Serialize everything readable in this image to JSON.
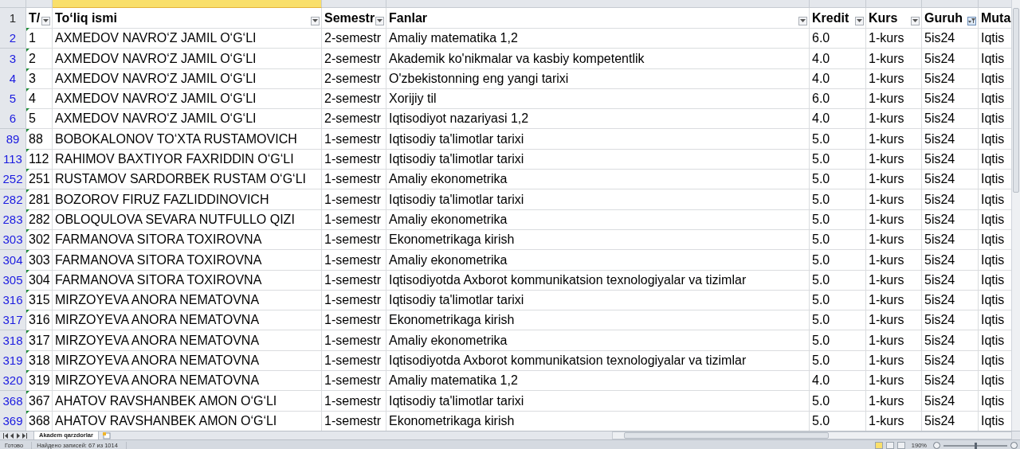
{
  "column_headers": [
    {
      "selected": false
    },
    {
      "selected": true
    },
    {
      "selected": false
    },
    {
      "selected": false
    },
    {
      "selected": false
    },
    {
      "selected": false
    },
    {
      "selected": false
    },
    {
      "selected": false
    }
  ],
  "header_row": {
    "number": "1",
    "cells": [
      {
        "text": "T/",
        "filter_button": true,
        "filtered": false
      },
      {
        "text": "To‘liq ismi",
        "filter_button": true,
        "filtered": false
      },
      {
        "text": "Semestr",
        "filter_button": true,
        "filtered": false
      },
      {
        "text": "Fanlar",
        "filter_button": true,
        "filtered": false
      },
      {
        "text": "Kredit",
        "filter_button": true,
        "filtered": false
      },
      {
        "text": "Kurs",
        "filter_button": true,
        "filtered": false
      },
      {
        "text": "Guruh",
        "filter_button": true,
        "filtered": true
      },
      {
        "text": "Muta",
        "filter_button": false
      }
    ]
  },
  "rows": [
    {
      "number": "2",
      "cells": [
        "1",
        "AXMEDOV NAVRO‘Z JAMIL O‘G‘LI",
        "2-semestr",
        "Amaliy matematika 1,2",
        "6.0",
        "1-kurs",
        "5is24",
        "Iqtis"
      ]
    },
    {
      "number": "3",
      "cells": [
        "2",
        "AXMEDOV NAVRO‘Z JAMIL O‘G‘LI",
        "2-semestr",
        "Akademik ko'nikmalar va kasbiy kompetentlik",
        "4.0",
        "1-kurs",
        "5is24",
        "Iqtis"
      ]
    },
    {
      "number": "4",
      "cells": [
        "3",
        "AXMEDOV NAVRO‘Z JAMIL O‘G‘LI",
        "2-semestr",
        "O'zbekistonning eng yangi tarixi",
        "4.0",
        "1-kurs",
        "5is24",
        "Iqtis"
      ]
    },
    {
      "number": "5",
      "cells": [
        "4",
        "AXMEDOV NAVRO‘Z JAMIL O‘G‘LI",
        "2-semestr",
        "Xorijiy til",
        "6.0",
        "1-kurs",
        "5is24",
        "Iqtis"
      ]
    },
    {
      "number": "6",
      "cells": [
        "5",
        "AXMEDOV NAVRO‘Z JAMIL O‘G‘LI",
        "2-semestr",
        "Iqtisodiyot nazariyasi 1,2",
        "4.0",
        "1-kurs",
        "5is24",
        "Iqtis"
      ]
    },
    {
      "number": "89",
      "cells": [
        "88",
        "BOBOKALONOV TO‘XTA RUSTAMOVICH",
        "1-semestr",
        "Iqtisodiy ta'limotlar tarixi",
        "5.0",
        "1-kurs",
        "5is24",
        "Iqtis"
      ]
    },
    {
      "number": "113",
      "cells": [
        "112",
        "RAHIMOV BAXTIYOR FAXRIDDIN O‘G‘LI",
        "1-semestr",
        "Iqtisodiy ta'limotlar tarixi",
        "5.0",
        "1-kurs",
        "5is24",
        "Iqtis"
      ]
    },
    {
      "number": "252",
      "cells": [
        "251",
        "RUSTAMOV SARDORBEK RUSTAM O‘G‘LI",
        "1-semestr",
        "Amaliy ekonometrika",
        "5.0",
        "1-kurs",
        "5is24",
        "Iqtis"
      ]
    },
    {
      "number": "282",
      "cells": [
        "281",
        "BOZOROV FIRUZ FAZLIDDINOVICH",
        "1-semestr",
        "Iqtisodiy ta'limotlar tarixi",
        "5.0",
        "1-kurs",
        "5is24",
        "Iqtis"
      ]
    },
    {
      "number": "283",
      "cells": [
        "282",
        "OBLOQULOVA SEVARA NUTFULLO QIZI",
        "1-semestr",
        "Amaliy ekonometrika",
        "5.0",
        "1-kurs",
        "5is24",
        "Iqtis"
      ]
    },
    {
      "number": "303",
      "cells": [
        "302",
        "FARMANOVA SITORA TOXIROVNA",
        "1-semestr",
        "Ekonometrikaga kirish",
        "5.0",
        "1-kurs",
        "5is24",
        "Iqtis"
      ]
    },
    {
      "number": "304",
      "cells": [
        "303",
        "FARMANOVA SITORA TOXIROVNA",
        "1-semestr",
        "Amaliy ekonometrika",
        "5.0",
        "1-kurs",
        "5is24",
        "Iqtis"
      ]
    },
    {
      "number": "305",
      "cells": [
        "304",
        "FARMANOVA SITORA TOXIROVNA",
        "1-semestr",
        "Iqtisodiyotda Axborot kommunikatsion texnologiyalar va tizimlar",
        "5.0",
        "1-kurs",
        "5is24",
        "Iqtis"
      ]
    },
    {
      "number": "316",
      "cells": [
        "315",
        "MIRZOYEVA ANORA NEMATOVNA",
        "1-semestr",
        "Iqtisodiy ta'limotlar tarixi",
        "5.0",
        "1-kurs",
        "5is24",
        "Iqtis"
      ]
    },
    {
      "number": "317",
      "cells": [
        "316",
        "MIRZOYEVA ANORA NEMATOVNA",
        "1-semestr",
        "Ekonometrikaga kirish",
        "5.0",
        "1-kurs",
        "5is24",
        "Iqtis"
      ]
    },
    {
      "number": "318",
      "cells": [
        "317",
        "MIRZOYEVA ANORA NEMATOVNA",
        "1-semestr",
        "Amaliy ekonometrika",
        "5.0",
        "1-kurs",
        "5is24",
        "Iqtis"
      ]
    },
    {
      "number": "319",
      "cells": [
        "318",
        "MIRZOYEVA ANORA NEMATOVNA",
        "1-semestr",
        "Iqtisodiyotda Axborot kommunikatsion texnologiyalar va tizimlar",
        "5.0",
        "1-kurs",
        "5is24",
        "Iqtis"
      ]
    },
    {
      "number": "320",
      "cells": [
        "319",
        "MIRZOYEVA ANORA NEMATOVNA",
        "1-semestr",
        "Amaliy matematika 1,2",
        "4.0",
        "1-kurs",
        "5is24",
        "Iqtis"
      ]
    },
    {
      "number": "368",
      "cells": [
        "367",
        "AHATOV RAVSHANBEK AMON O‘G‘LI",
        "1-semestr",
        "Iqtisodiy ta'limotlar tarixi",
        "5.0",
        "1-kurs",
        "5is24",
        "Iqtis"
      ]
    },
    {
      "number": "369",
      "cells": [
        "368",
        "AHATOV RAVSHANBEK AMON O‘G‘LI",
        "1-semestr",
        "Ekonometrikaga kirish",
        "5.0",
        "1-kurs",
        "5is24",
        "Iqtis"
      ]
    }
  ],
  "sheet_tabs": [
    {
      "label": "Akadem qarzdorlar",
      "selected": true
    }
  ],
  "status_bar": {
    "state": "Готово",
    "filter_summary": "Найдено записей: 67 из 1014",
    "zoom": "190%",
    "level": 0.5
  }
}
